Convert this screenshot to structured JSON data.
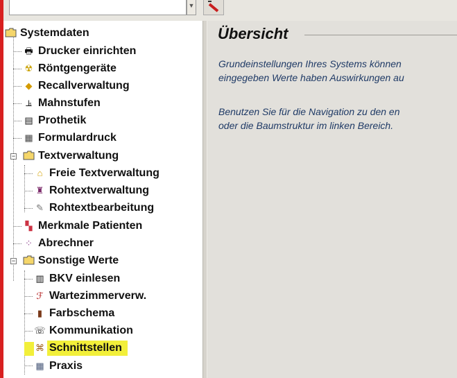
{
  "main": {
    "title": "Übersicht",
    "para1_line1": "Grundeinstellungen Ihres Systems können",
    "para1_line2": "eingegeben Werte haben Auswirkungen au",
    "para2_line1": "Benutzen Sie für die Navigation zu den en",
    "para2_line2": "oder die Baumstruktur im linken Bereich."
  },
  "tree": {
    "root": "Systemdaten",
    "items": [
      {
        "label": "Drucker einrichten",
        "icon": "printer-icon"
      },
      {
        "label": "Röntgengeräte",
        "icon": "radiation-icon"
      },
      {
        "label": "Recallverwaltung",
        "icon": "recall-icon"
      },
      {
        "label": "Mahnstufen",
        "icon": "stairs-icon"
      },
      {
        "label": "Prothetik",
        "icon": "prosthesis-icon"
      },
      {
        "label": "Formulardruck",
        "icon": "form-print-icon"
      },
      {
        "label": "Textverwaltung",
        "icon": "folder-icon"
      },
      {
        "label": "Freie Textverwaltung",
        "icon": "text-folder-icon"
      },
      {
        "label": "Rohtextverwaltung",
        "icon": "raw-text-icon"
      },
      {
        "label": "Rohtextbearbeitung",
        "icon": "edit-text-icon"
      },
      {
        "label": "Merkmale Patienten",
        "icon": "patient-features-icon"
      },
      {
        "label": "Abrechner",
        "icon": "billing-icon"
      },
      {
        "label": "Sonstige Werte",
        "icon": "folder-icon"
      },
      {
        "label": "BKV einlesen",
        "icon": "bkv-icon"
      },
      {
        "label": "Wartezimmerverw.",
        "icon": "waiting-room-icon"
      },
      {
        "label": "Farbschema",
        "icon": "color-scheme-icon"
      },
      {
        "label": "Kommunikation",
        "icon": "communication-icon"
      },
      {
        "label": "Schnittstellen",
        "icon": "interface-icon"
      },
      {
        "label": "Praxis",
        "icon": "practice-icon"
      }
    ]
  },
  "colors": {
    "highlight": "#f2ef3a",
    "accent_red": "#d82020",
    "text_blue": "#1f3a66"
  }
}
